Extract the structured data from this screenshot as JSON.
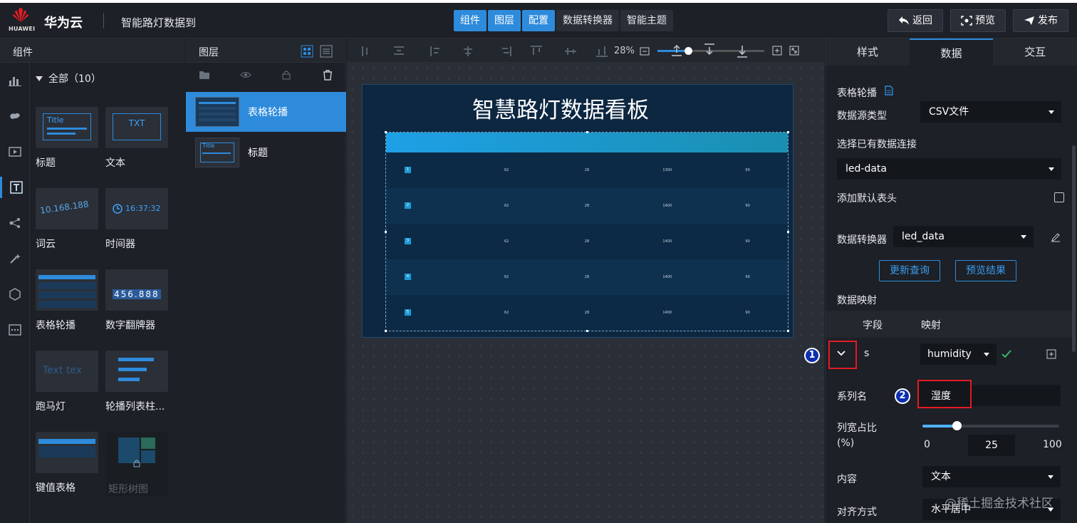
{
  "topbar": {
    "logo_text": "HUAWEI",
    "brand": "华为云",
    "project_title": "智能路灯数据到",
    "center_tabs": [
      {
        "label": "组件",
        "active": true
      },
      {
        "label": "图层",
        "active": true
      },
      {
        "label": "配置",
        "active": true
      },
      {
        "label": "数据转换器",
        "active": false
      },
      {
        "label": "智能主题",
        "active": false
      }
    ],
    "buttons": {
      "back": "返回",
      "preview": "预览",
      "publish": "发布"
    }
  },
  "components": {
    "title": "组件",
    "filter": "全部（10）",
    "items": [
      {
        "label": "标题",
        "thumb_text": "Title"
      },
      {
        "label": "文本",
        "thumb_text": "TXT"
      },
      {
        "label": "词云",
        "thumb_text": "10.168.188"
      },
      {
        "label": "时间器",
        "thumb_text": "16:37:32"
      },
      {
        "label": "表格轮播",
        "thumb_text": ""
      },
      {
        "label": "数字翻牌器",
        "thumb_text": "456.888"
      },
      {
        "label": "跑马灯",
        "thumb_text": "Text tex"
      },
      {
        "label": "轮播列表柱...",
        "thumb_text": ""
      },
      {
        "label": "键值表格",
        "thumb_text": ""
      },
      {
        "label": "矩形树图",
        "thumb_text": ""
      }
    ]
  },
  "layers": {
    "title": "图层",
    "items": [
      {
        "label": "表格轮播",
        "selected": true
      },
      {
        "label": "标题",
        "selected": false
      }
    ]
  },
  "toolbar": {
    "zoom": "28%"
  },
  "board": {
    "title": "智慧路灯数据看板",
    "table_rows": [
      {
        "idx": "1",
        "c1": "62",
        "c2": "28",
        "c3": "1300",
        "c4": "90"
      },
      {
        "idx": "2",
        "c1": "62",
        "c2": "28",
        "c3": "1400",
        "c4": "90"
      },
      {
        "idx": "3",
        "c1": "62",
        "c2": "28",
        "c3": "1400",
        "c4": "90"
      },
      {
        "idx": "4",
        "c1": "62",
        "c2": "28",
        "c3": "1400",
        "c4": "90"
      },
      {
        "idx": "5",
        "c1": "62",
        "c2": "28",
        "c3": "1400",
        "c4": "90"
      }
    ]
  },
  "right": {
    "tabs": [
      {
        "label": "样式",
        "active": false
      },
      {
        "label": "数据",
        "active": true
      },
      {
        "label": "交互",
        "active": false
      }
    ],
    "section_title": "表格轮播",
    "datasource_type_label": "数据源类型",
    "datasource_type_value": "CSV文件",
    "connection_label": "选择已有数据连接",
    "connection_value": "led-data",
    "default_header_label": "添加默认表头",
    "converter_label": "数据转换器",
    "converter_value": "led_data",
    "refresh_btn": "更新查询",
    "preview_btn": "预览结果",
    "mapping_title": "数据映射",
    "mapping_header": {
      "field": "字段",
      "map": "映射"
    },
    "mapping_row": {
      "field": "s",
      "value": "humidity"
    },
    "series_label": "系列名",
    "series_value": "湿度",
    "width_label": "列宽占比",
    "width_unit": "(%)",
    "width_min": "0",
    "width_value": "25",
    "width_max": "100",
    "width_fraction": 0.25,
    "content_label": "内容",
    "content_value": "文本",
    "align_label": "对齐方式",
    "align_value": "水平居中",
    "annotations": [
      "1",
      "2"
    ]
  },
  "watermark": "@稀土掘金技术社区"
}
